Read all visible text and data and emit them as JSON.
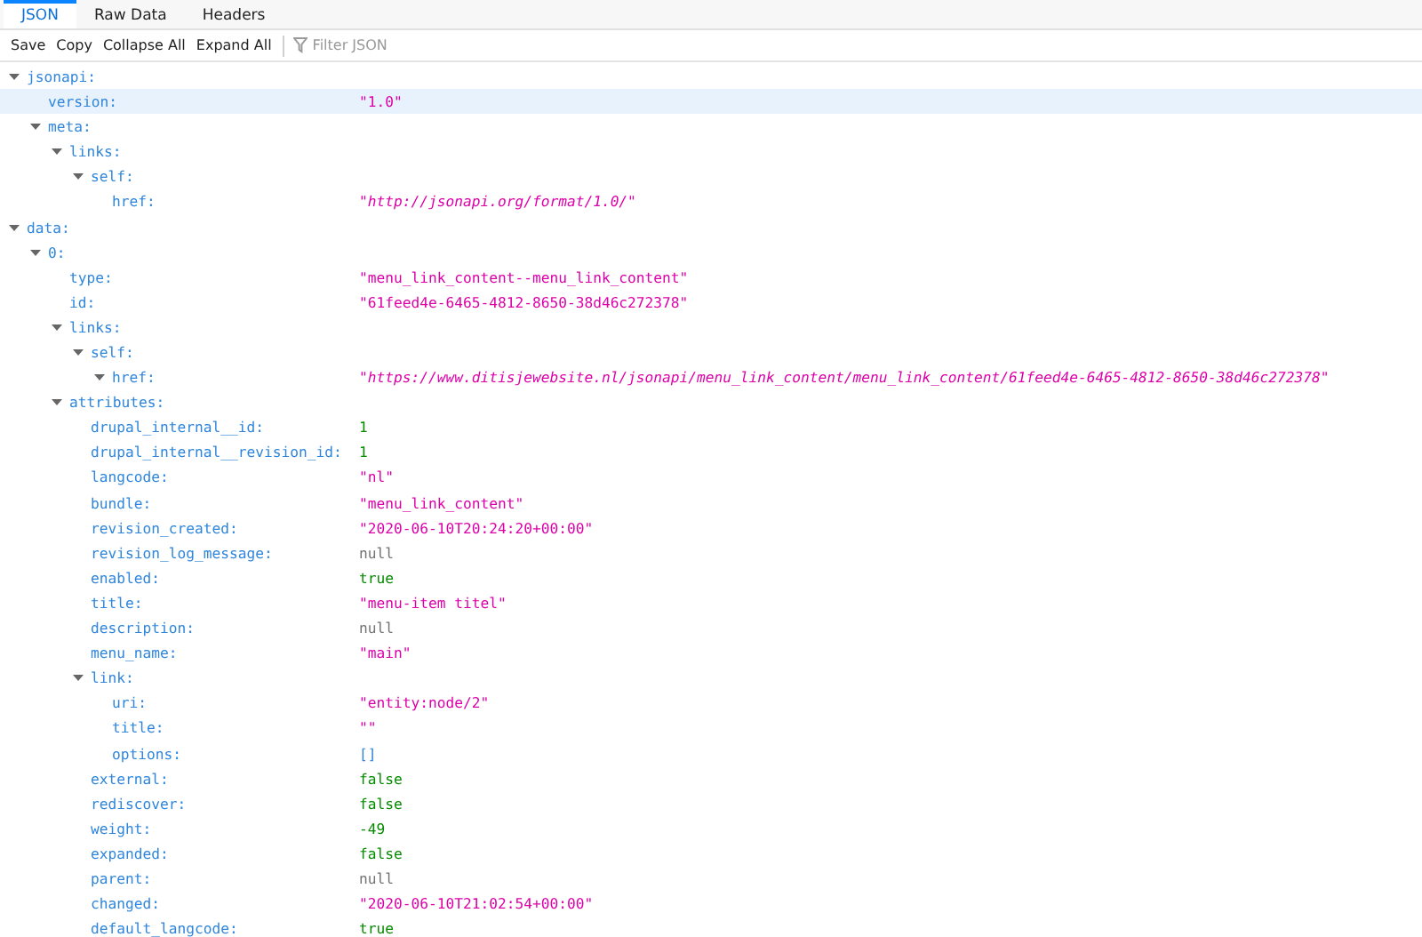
{
  "tabs": [
    {
      "label": "JSON",
      "selected": true
    },
    {
      "label": "Raw Data",
      "selected": false
    },
    {
      "label": "Headers",
      "selected": false
    }
  ],
  "toolbar": {
    "buttons": [
      "Save",
      "Copy",
      "Collapse All",
      "Expand All"
    ],
    "filter": {
      "placeholder": "Filter JSON"
    }
  },
  "tree": [
    {
      "key": "jsonapi:",
      "kind": "object",
      "expanded": true,
      "selected": false,
      "children": [
        {
          "key": "version:",
          "kind": "string",
          "value": "\"1.0\"",
          "selected": true
        },
        {
          "key": "meta:",
          "kind": "object",
          "expanded": true,
          "selected": false,
          "children": [
            {
              "key": "links:",
              "kind": "object",
              "expanded": true,
              "selected": false,
              "children": [
                {
                  "key": "self:",
                  "kind": "object",
                  "expanded": true,
                  "selected": false,
                  "children": [
                    {
                      "key": "href:",
                      "kind": "url",
                      "value": "\"http://jsonapi.org/format/1.0/\"",
                      "selected": false
                    }
                  ]
                }
              ]
            }
          ]
        }
      ]
    },
    {
      "key": "data:",
      "kind": "object",
      "expanded": true,
      "selected": false,
      "children": [
        {
          "key": "0:",
          "kind": "object",
          "expanded": true,
          "selected": false,
          "children": [
            {
              "key": "type:",
              "kind": "string",
              "value": "\"menu_link_content--menu_link_content\"",
              "selected": false
            },
            {
              "key": "id:",
              "kind": "string",
              "value": "\"61feed4e-6465-4812-8650-38d46c272378\"",
              "selected": false
            },
            {
              "key": "links:",
              "kind": "object",
              "expanded": true,
              "selected": false,
              "children": [
                {
                  "key": "self:",
                  "kind": "object",
                  "expanded": true,
                  "selected": false,
                  "children": [
                    {
                      "key": "href:",
                      "kind": "url",
                      "expanded": true,
                      "value": "\"https://www.ditisjewebsite.nl/jsonapi/menu_link_content/menu_link_content/61feed4e-6465-4812-8650-38d46c272378\"",
                      "selected": false
                    }
                  ]
                }
              ]
            },
            {
              "key": "attributes:",
              "kind": "object",
              "expanded": true,
              "selected": false,
              "children": [
                {
                  "key": "drupal_internal__id:",
                  "kind": "number",
                  "value": "1",
                  "selected": false
                },
                {
                  "key": "drupal_internal__revision_id:",
                  "kind": "number",
                  "value": "1",
                  "selected": false
                },
                {
                  "key": "langcode:",
                  "kind": "string",
                  "value": "\"nl\"",
                  "selected": false
                },
                {
                  "key": "bundle:",
                  "kind": "string",
                  "value": "\"menu_link_content\"",
                  "selected": false
                },
                {
                  "key": "revision_created:",
                  "kind": "string",
                  "value": "\"2020-06-10T20:24:20+00:00\"",
                  "selected": false
                },
                {
                  "key": "revision_log_message:",
                  "kind": "null",
                  "value": "null",
                  "selected": false
                },
                {
                  "key": "enabled:",
                  "kind": "boolean",
                  "value": "true",
                  "selected": false
                },
                {
                  "key": "title:",
                  "kind": "string",
                  "value": "\"menu-item titel\"",
                  "selected": false
                },
                {
                  "key": "description:",
                  "kind": "null",
                  "value": "null",
                  "selected": false
                },
                {
                  "key": "menu_name:",
                  "kind": "string",
                  "value": "\"main\"",
                  "selected": false
                },
                {
                  "key": "link:",
                  "kind": "object",
                  "expanded": true,
                  "selected": false,
                  "children": [
                    {
                      "key": "uri:",
                      "kind": "string",
                      "value": "\"entity:node/2\"",
                      "selected": false
                    },
                    {
                      "key": "title:",
                      "kind": "string",
                      "value": "\"\"",
                      "selected": false
                    },
                    {
                      "key": "options:",
                      "kind": "array",
                      "value": "[]",
                      "selected": false
                    }
                  ]
                },
                {
                  "key": "external:",
                  "kind": "boolean",
                  "value": "false",
                  "selected": false
                },
                {
                  "key": "rediscover:",
                  "kind": "boolean",
                  "value": "false",
                  "selected": false
                },
                {
                  "key": "weight:",
                  "kind": "number",
                  "value": "-49",
                  "selected": false
                },
                {
                  "key": "expanded:",
                  "kind": "boolean",
                  "value": "false",
                  "selected": false
                },
                {
                  "key": "parent:",
                  "kind": "null",
                  "value": "null",
                  "selected": false
                },
                {
                  "key": "changed:",
                  "kind": "string",
                  "value": "\"2020-06-10T21:02:54+00:00\"",
                  "selected": false
                },
                {
                  "key": "default_langcode:",
                  "kind": "boolean",
                  "value": "true",
                  "selected": false
                }
              ]
            }
          ]
        }
      ]
    }
  ]
}
